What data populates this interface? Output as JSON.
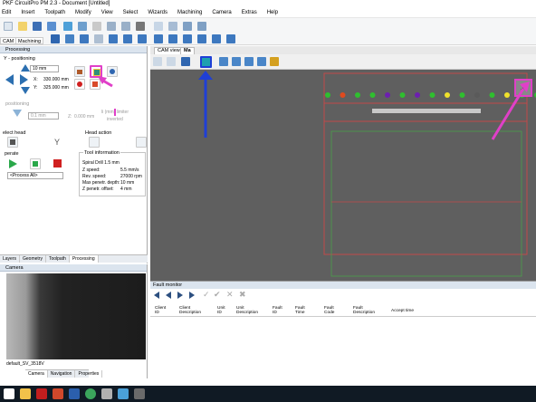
{
  "window": {
    "title": "PKF CircuitPro PM 2.3 - Document [Untitled]"
  },
  "menu": [
    "Edit",
    "Insert",
    "Toolpath",
    "Modify",
    "View",
    "Select",
    "Wizards",
    "Machining",
    "Camera",
    "Extras",
    "Help"
  ],
  "toolbar": {
    "tab_cam": "CAM",
    "tab_machining": "Machining"
  },
  "processing": {
    "title": "Processing",
    "positioning_label": "Y - positioning",
    "step": "10 mm",
    "x_label": "X:",
    "x_value": "330.000 mm",
    "y_label": "Y:",
    "y_value": "325.000 mm",
    "z_section": "positioning",
    "z_step": "0.1 mm",
    "z_label": "Z:",
    "z_value": "0.000 mm",
    "limit_label": "li (mm) limiter",
    "limit_sub": "inverted",
    "select_head": "elect head",
    "head_action": "Head action",
    "operate": "perate",
    "process_select": "<Process All>",
    "tool_info_title": "Tool information",
    "tool_name": "Spiral Drill 1.5 mm",
    "tool_rows": [
      {
        "label": "Z speed:",
        "value": "5.5 mm/s"
      },
      {
        "label": "Rev. speed:",
        "value": "27000 rpm"
      },
      {
        "label": "Max penetr. depth:",
        "value": "10 mm"
      },
      {
        "label": "Z penetr. offset:",
        "value": "4 mm"
      }
    ]
  },
  "left_tabs": [
    "Layers",
    "Geometry",
    "Toolpath",
    "Processing"
  ],
  "camera": {
    "title": "Camera",
    "device": "default_SV_3518V",
    "tabs": [
      "Camera",
      "Navigation",
      "Properties"
    ]
  },
  "viewport": {
    "tabs": [
      "CAM view",
      "Ma"
    ],
    "dot_colors": [
      "#2fbf2f",
      "#e04a1e",
      "#2fbf2f",
      "#2fbf2f",
      "#6d1fb0",
      "#2fbf2f",
      "#6d1fb0",
      "#2fbf2f",
      "#f0e12b",
      "#2fbf2f",
      "#5a5a5a",
      "#2fbf2f",
      "#f0e12b",
      "#2fbf2f",
      "#2fbf2f"
    ]
  },
  "fault_monitor": {
    "title": "Fault monitor",
    "columns": [
      [
        "Client",
        "ID"
      ],
      [
        "Client",
        "Description"
      ],
      [
        "Unit",
        "ID"
      ],
      [
        "Unit",
        "Description"
      ],
      [
        "Fault",
        "ID"
      ],
      [
        "Fault",
        "Time"
      ],
      [
        "Fault",
        "Code"
      ],
      [
        "Fault",
        "Description"
      ],
      [
        "Accept time",
        ""
      ]
    ]
  },
  "annotations": {
    "highlight_magenta": "#e040c8",
    "highlight_blue": "#1f3fd6"
  },
  "taskbar_apps": [
    "windows-start",
    "file-explorer",
    "acrobat",
    "powerpoint",
    "word",
    "chrome",
    "circuitpro",
    "settings",
    "app"
  ]
}
